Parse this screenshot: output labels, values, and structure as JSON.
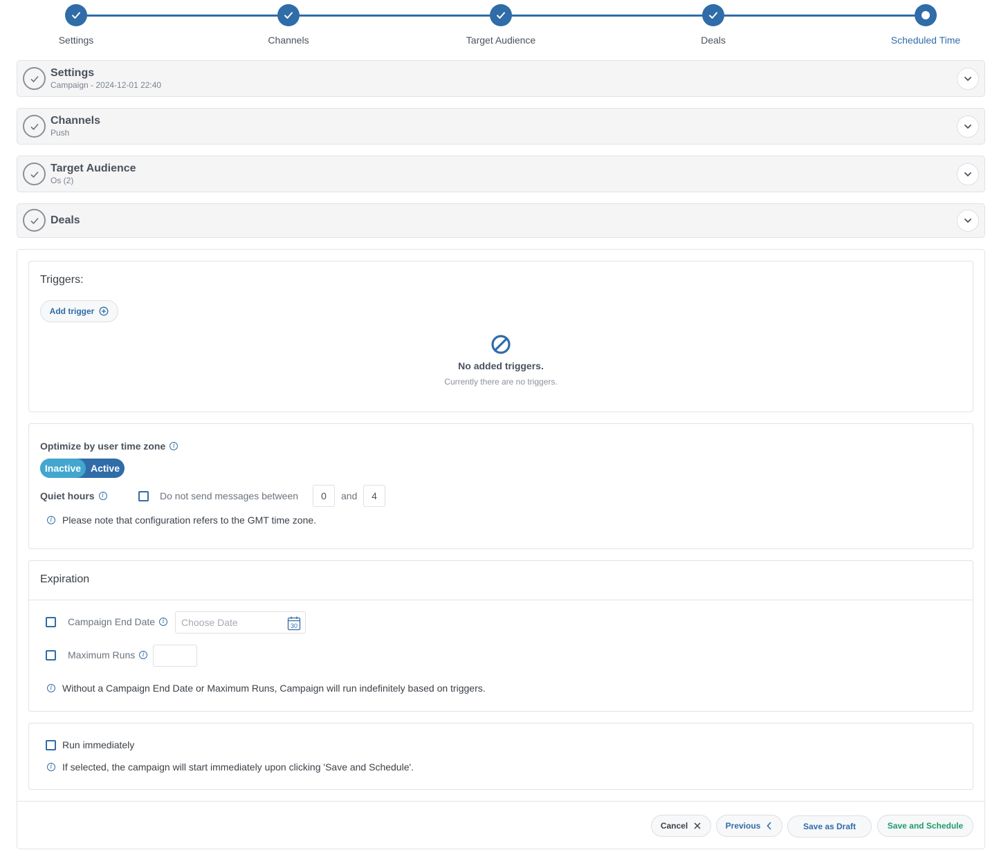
{
  "stepper": {
    "steps": [
      {
        "label": "Settings",
        "state": "complete"
      },
      {
        "label": "Channels",
        "state": "complete"
      },
      {
        "label": "Target Audience",
        "state": "complete"
      },
      {
        "label": "Deals",
        "state": "complete"
      },
      {
        "label": "Scheduled Time",
        "state": "current"
      }
    ]
  },
  "sections": [
    {
      "title": "Settings",
      "subtitle": "Campaign - 2024-12-01 22:40"
    },
    {
      "title": "Channels",
      "subtitle": "Push"
    },
    {
      "title": "Target Audience",
      "subtitle": "Os (2)"
    },
    {
      "title": "Deals",
      "subtitle": ""
    }
  ],
  "triggers": {
    "title": "Triggers:",
    "add_label": "Add trigger",
    "empty_title": "No added triggers.",
    "empty_subtitle": "Currently there are no triggers."
  },
  "timezone": {
    "optimize_label": "Optimize by user time zone",
    "toggle_inactive": "Inactive",
    "toggle_active": "Active",
    "toggle_state": "Inactive",
    "quiet_label": "Quiet hours",
    "quiet_checkbox_label": "Do not send messages between",
    "quiet_from": "0",
    "quiet_and": "and",
    "quiet_to": "4",
    "note": "Please note that configuration refers to the GMT time zone."
  },
  "expiration": {
    "title": "Expiration",
    "end_date_label": "Campaign End Date",
    "end_date_placeholder": "Choose Date",
    "calendar_day": "30",
    "max_runs_label": "Maximum Runs",
    "max_runs_value": "",
    "note": "Without a Campaign End Date or Maximum Runs, Campaign will run indefinitely based on triggers."
  },
  "run_immediately": {
    "label": "Run immediately",
    "note": "If selected, the campaign will start immediately upon clicking 'Save and Schedule'."
  },
  "footer": {
    "cancel": "Cancel",
    "previous": "Previous",
    "save_draft": "Save as Draft",
    "save_schedule": "Save and Schedule"
  },
  "colors": {
    "primary": "#2f6ca8",
    "toggle_inactive": "#42a6cf",
    "success_text": "#1f9a6a"
  }
}
